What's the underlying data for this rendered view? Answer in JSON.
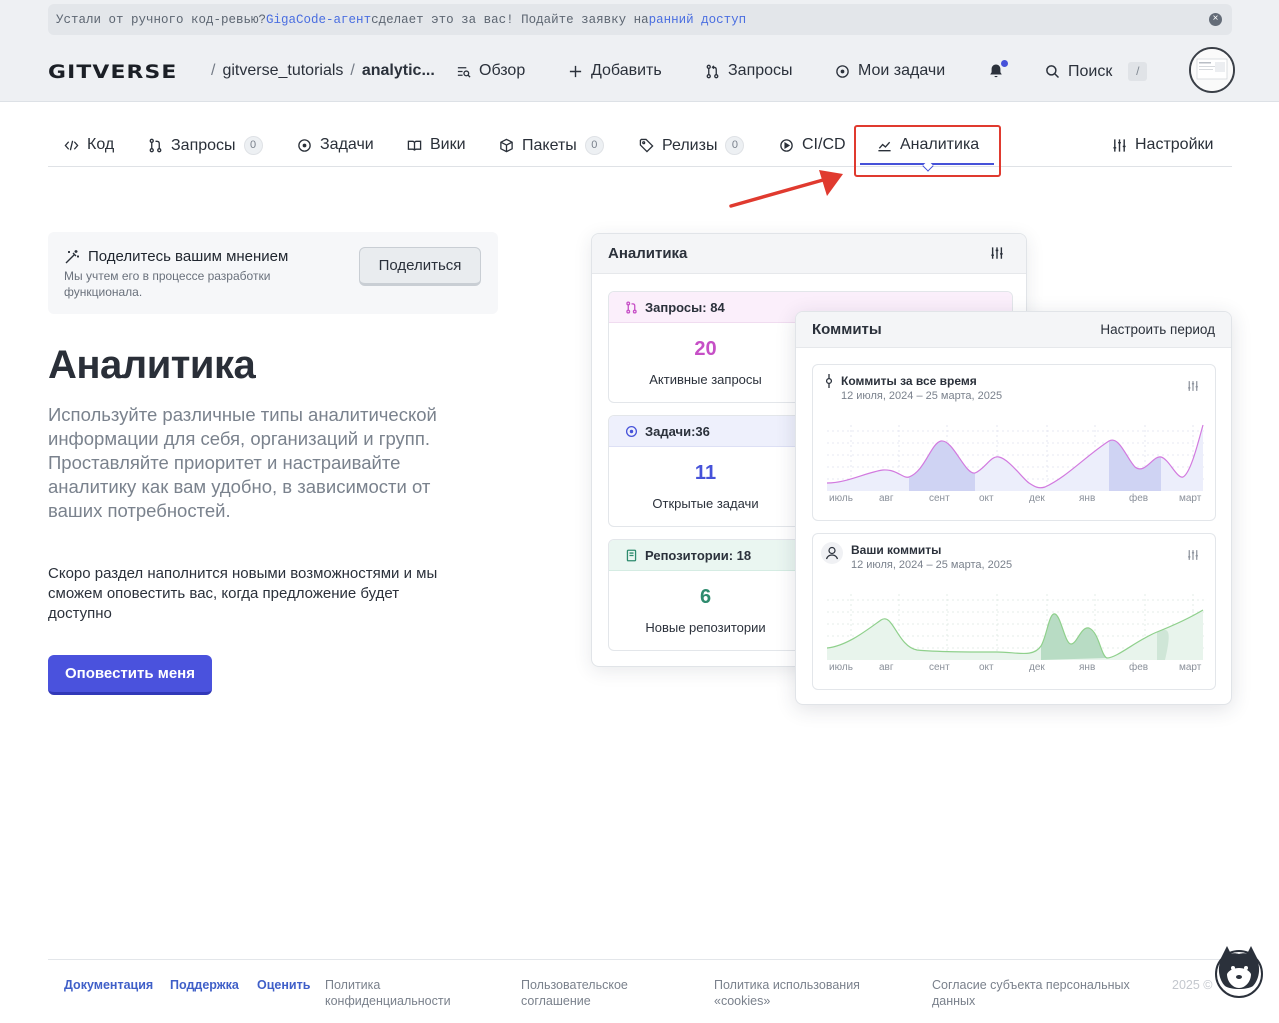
{
  "banner": {
    "text_before": "Устали от ручного код-ревью? ",
    "link1": "GigaCode-агент",
    "text_middle": " сделает это за вас! Подайте заявку на ",
    "link2": "ранний доступ"
  },
  "header": {
    "logo": "GITVERSE",
    "org": "gitverse_tutorials",
    "repo": "analytic...",
    "nav": {
      "overview": "Обзор",
      "add": "Добавить",
      "requests": "Запросы",
      "my_tasks": "Мои задачи",
      "search": "Поиск",
      "search_key": "/"
    }
  },
  "tabs": {
    "code": "Код",
    "requests": "Запросы",
    "requests_count": "0",
    "tasks": "Задачи",
    "wiki": "Вики",
    "packages": "Пакеты",
    "packages_count": "0",
    "releases": "Релизы",
    "releases_count": "0",
    "cicd": "CI/CD",
    "analytics": "Аналитика",
    "settings": "Настройки"
  },
  "feedback": {
    "title": "Поделитесь вашим мнением",
    "subtitle": "Мы учтем его в процессе разработки функционала.",
    "button": "Поделиться"
  },
  "main": {
    "title": "Аналитика",
    "lead": "Используйте различные типы аналитической информации для себя, организаций и групп. Проставляйте приоритет и настраивайте аналитику как вам удобно, в зависимости от ваших потребностей.",
    "note": "Скоро раздел наполнится новыми возможностями и мы сможем оповестить вас, когда предложение будет доступно",
    "notify_button": "Оповестить меня"
  },
  "preview_analytics": {
    "title": "Аналитика",
    "stats": [
      {
        "header": "Запросы: 84",
        "value": "20",
        "label": "Активные запросы"
      },
      {
        "header": "Задачи:36",
        "value": "11",
        "label": "Открытые задачи"
      },
      {
        "header": "Репозитории: 18",
        "value": "6",
        "label": "Новые репозитории"
      }
    ]
  },
  "preview_commits": {
    "title": "Коммиты",
    "period_button": "Настроить период",
    "charts": [
      {
        "title": "Коммиты за все время",
        "range": "12 июля, 2024 – 25 марта, 2025"
      },
      {
        "title": "Ваши коммиты",
        "range": "12 июля, 2024 – 25 марта, 2025"
      }
    ],
    "months": [
      "июль",
      "авг",
      "сент",
      "окт",
      "дек",
      "янв",
      "фев",
      "март"
    ]
  },
  "footer": {
    "docs": "Документация",
    "support": "Поддержка",
    "rate": "Оценить",
    "privacy": "Политика конфиденциальности",
    "agreement": "Пользовательское соглашение",
    "cookies": "Политика использования «cookies»",
    "consent": "Согласие субъекта персональных данных",
    "year": "2025 ©"
  },
  "colors": {
    "accent": "#4652d9",
    "highlight": "#e03a2f",
    "requests": "#c64fc6",
    "tasks": "#4652d9",
    "repos": "#2e8b6e"
  }
}
